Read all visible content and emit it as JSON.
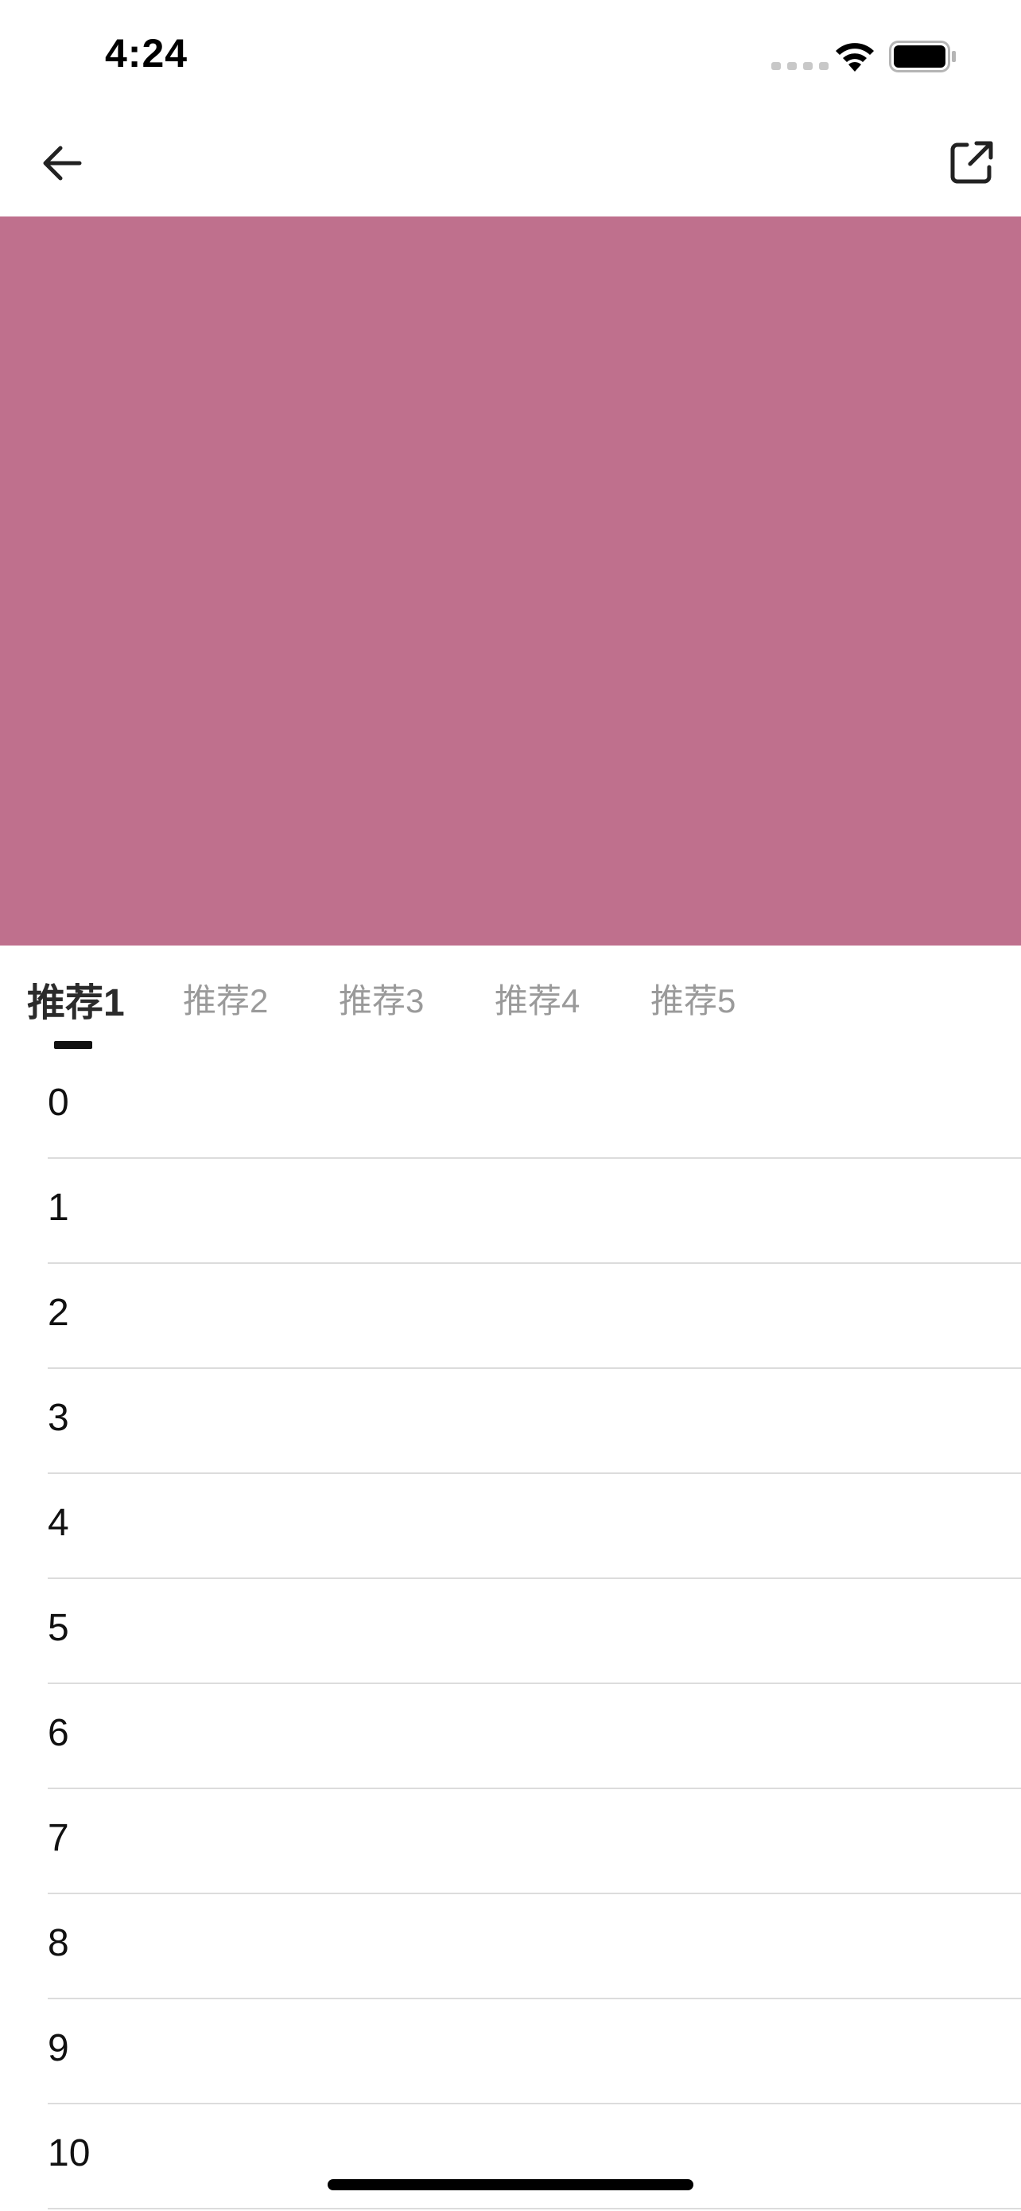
{
  "status_bar": {
    "time": "4:24"
  },
  "nav": {
    "back_icon": "back-arrow-icon",
    "share_icon": "share-external-icon"
  },
  "hero": {
    "color": "#bf708d"
  },
  "tabs": [
    {
      "label": "推荐1",
      "active": true
    },
    {
      "label": "推荐2",
      "active": false
    },
    {
      "label": "推荐3",
      "active": false
    },
    {
      "label": "推荐4",
      "active": false
    },
    {
      "label": "推荐5",
      "active": false
    }
  ],
  "list": {
    "items": [
      {
        "label": "0"
      },
      {
        "label": "1"
      },
      {
        "label": "2"
      },
      {
        "label": "3"
      },
      {
        "label": "4"
      },
      {
        "label": "5"
      },
      {
        "label": "6"
      },
      {
        "label": "7"
      },
      {
        "label": "8"
      },
      {
        "label": "9"
      },
      {
        "label": "10"
      }
    ]
  }
}
